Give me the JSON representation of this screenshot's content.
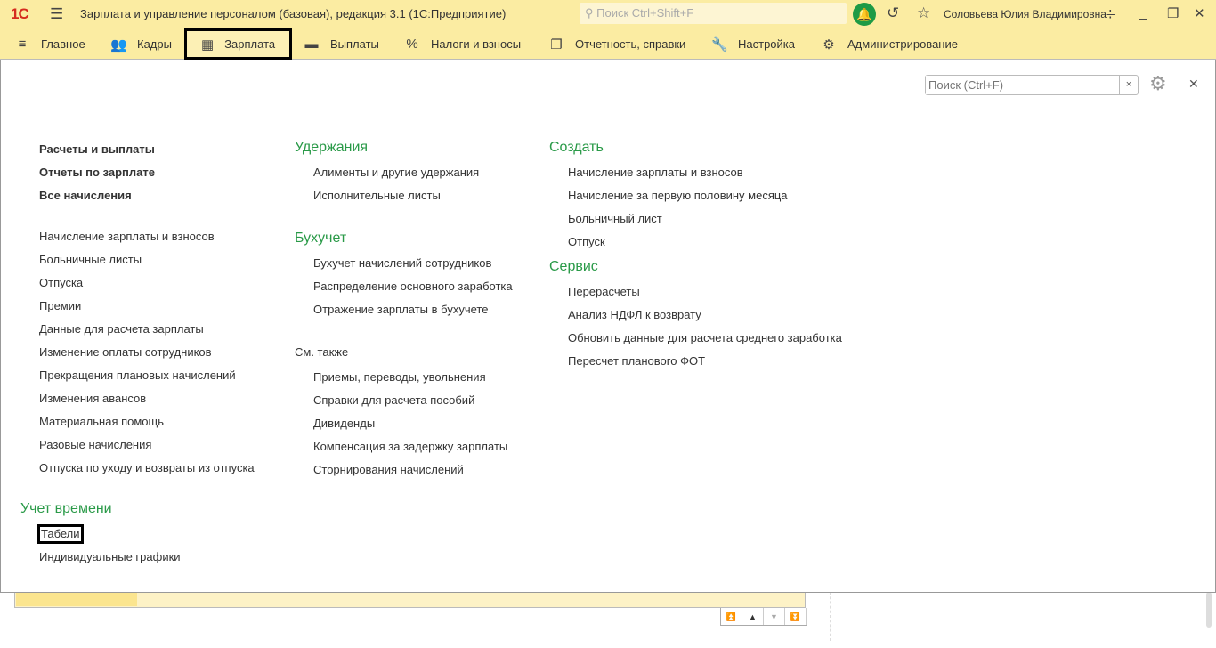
{
  "titlebar": {
    "logo": "1С",
    "title": "Зарплата и управление персоналом (базовая), редакция 3.1  (1С:Предприятие)",
    "search_placeholder": "Поиск Ctrl+Shift+F",
    "user": "Соловьева Юлия Владимировна"
  },
  "nav": [
    {
      "label": "Главное",
      "icon": "≡"
    },
    {
      "label": "Кадры",
      "icon": "👥"
    },
    {
      "label": "Зарплата",
      "icon": "▦"
    },
    {
      "label": "Выплаты",
      "icon": "▬"
    },
    {
      "label": "Налоги и взносы",
      "icon": "%"
    },
    {
      "label": "Отчетность, справки",
      "icon": "❐"
    },
    {
      "label": "Настройка",
      "icon": "🔧"
    },
    {
      "label": "Администрирование",
      "icon": "⚙"
    }
  ],
  "panel": {
    "search_placeholder": "Поиск (Ctrl+F)",
    "col1_bold": [
      "Расчеты и выплаты",
      "Отчеты по зарплате",
      "Все начисления"
    ],
    "col1_links": [
      "Начисление зарплаты и взносов",
      "Больничные листы",
      "Отпуска",
      "Премии",
      "Данные для расчета зарплаты",
      "Изменение оплаты сотрудников",
      "Прекращения плановых начислений",
      "Изменения авансов",
      "Материальная помощь",
      "Разовые начисления",
      "Отпуска по уходу и возвраты из отпуска"
    ],
    "time": {
      "heading": "Учет времени",
      "items": [
        "Табели",
        "Индивидуальные графики"
      ]
    },
    "uderzhania": {
      "heading": "Удержания",
      "items": [
        "Алименты и другие удержания",
        "Исполнительные листы"
      ]
    },
    "buhuchet": {
      "heading": "Бухучет",
      "items": [
        "Бухучет начислений сотрудников",
        "Распределение основного заработка",
        "Отражение зарплаты в бухучете"
      ]
    },
    "see_also": {
      "heading": "См. также",
      "items": [
        "Приемы, переводы, увольнения",
        "Справки для расчета пособий",
        "Дивиденды",
        "Компенсация за задержку зарплаты",
        "Сторнирования начислений"
      ]
    },
    "create": {
      "heading": "Создать",
      "items": [
        "Начисление зарплаты и взносов",
        "Начисление за первую половину месяца",
        "Больничный лист",
        "Отпуск"
      ]
    },
    "service": {
      "heading": "Сервис",
      "items": [
        "Перерасчеты",
        "Анализ НДФЛ к возврату",
        "Обновить данные для расчета среднего заработка",
        "Пересчет планового ФОТ"
      ]
    }
  }
}
